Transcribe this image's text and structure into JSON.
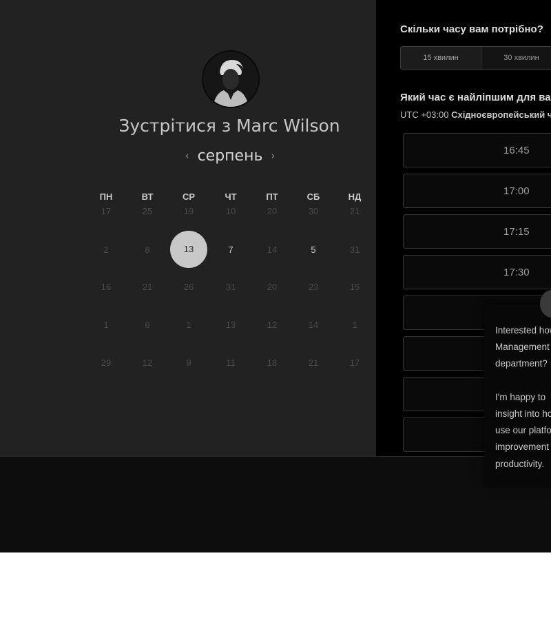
{
  "host": {
    "meet_title": "Зустрітися з Marc Wilson",
    "avatar_icon": "person-avatar"
  },
  "calendar": {
    "month": "серпень",
    "prev_icon": "chevron-left-icon",
    "next_icon": "chevron-right-icon",
    "weekdays": [
      "ПН",
      "ВТ",
      "СР",
      "ЧТ",
      "ПТ",
      "СБ",
      "НД"
    ],
    "weeks": [
      [
        "17",
        "25",
        "19",
        "10",
        "20",
        "30",
        "21"
      ],
      [
        "2",
        "8",
        "13",
        "7",
        "14",
        "5",
        "31"
      ],
      [
        "16",
        "21",
        "26",
        "31",
        "20",
        "23",
        "15"
      ],
      [
        "1",
        "6",
        "1",
        "13",
        "12",
        "14",
        "1"
      ],
      [
        "29",
        "12",
        "9",
        "11",
        "18",
        "21",
        "17"
      ]
    ],
    "selected_day": "13"
  },
  "booking": {
    "duration_question": "Скільки часу вам потрібно?",
    "durations": [
      "15 хвилин",
      "30 хвилин"
    ],
    "active_duration": "15 хвилин",
    "time_question": "Який час є найліпшим для вас?",
    "timezone_offset": "UTC +03:00",
    "timezone_name": "Східноєвропейський час",
    "slots": [
      "16:45",
      "17:00",
      "17:15",
      "17:30",
      "",
      "",
      ""
    ]
  },
  "chat": {
    "message": "Interested how\nManagement\ndepartment?\n\nI'm happy to\ninsight into how\nuse our platform\nimprovement\nproductivity."
  },
  "colors": {
    "left_panel": "#222222",
    "right_panel": "#000000",
    "selected_day_bg": "#c8c8c8"
  }
}
